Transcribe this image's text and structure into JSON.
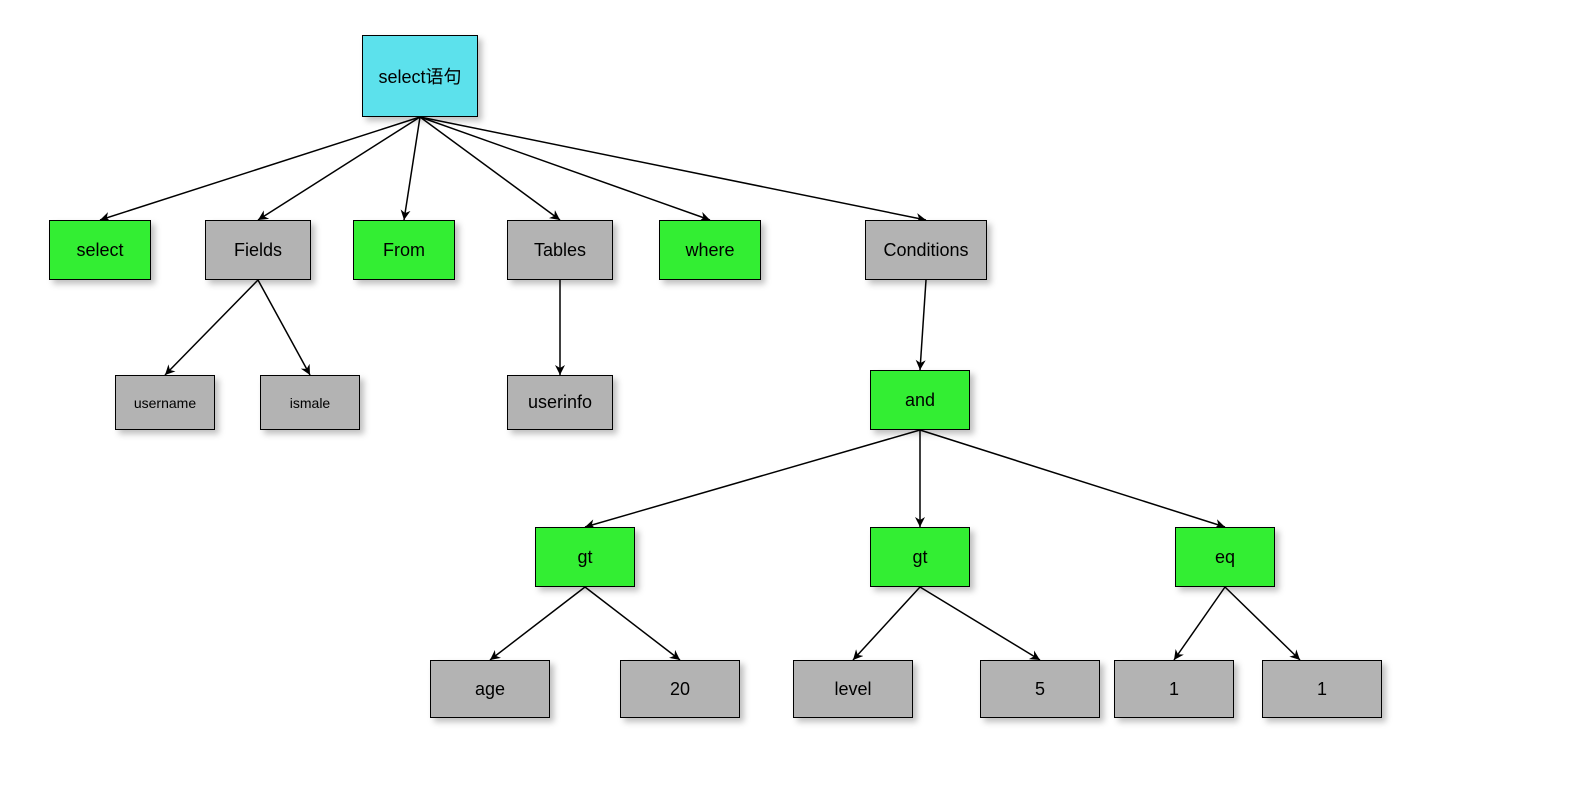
{
  "colors": {
    "root": "#5ce1ec",
    "keyword": "#33ee33",
    "value": "#b3b3b3"
  },
  "nodes": {
    "root": "select语句",
    "select": "select",
    "fields": "Fields",
    "from": "From",
    "tables": "Tables",
    "where": "where",
    "conditions": "Conditions",
    "username": "username",
    "ismale": "ismale",
    "userinfo": "userinfo",
    "and": "and",
    "gt1": "gt",
    "gt2": "gt",
    "eq": "eq",
    "age": "age",
    "v20": "20",
    "level": "level",
    "v5": "5",
    "v1a": "1",
    "v1b": "1"
  }
}
